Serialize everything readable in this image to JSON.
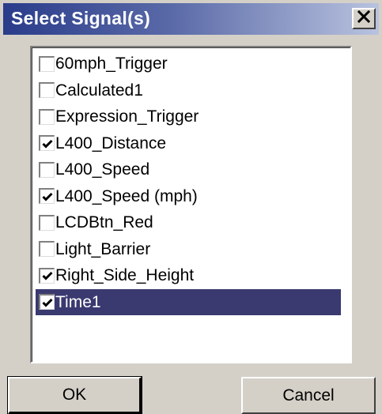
{
  "window": {
    "title": "Select Signal(s)",
    "close_icon": "close-x-icon"
  },
  "signals": [
    {
      "label": "60mph_Trigger",
      "checked": false,
      "selected": false
    },
    {
      "label": "Calculated1",
      "checked": false,
      "selected": false
    },
    {
      "label": "Expression_Trigger",
      "checked": false,
      "selected": false
    },
    {
      "label": "L400_Distance",
      "checked": true,
      "selected": false
    },
    {
      "label": "L400_Speed",
      "checked": false,
      "selected": false
    },
    {
      "label": "L400_Speed (mph)",
      "checked": true,
      "selected": false
    },
    {
      "label": "LCDBtn_Red",
      "checked": false,
      "selected": false
    },
    {
      "label": "Light_Barrier",
      "checked": false,
      "selected": false
    },
    {
      "label": "Right_Side_Height",
      "checked": true,
      "selected": false
    },
    {
      "label": "Time1",
      "checked": true,
      "selected": true
    }
  ],
  "buttons": {
    "ok_label": "OK",
    "cancel_label": "Cancel"
  },
  "colors": {
    "title_gradient_start": "#2a3c8a",
    "title_gradient_end": "#b9c3df",
    "selection": "#3a3a70",
    "face": "#d4d0c8"
  }
}
